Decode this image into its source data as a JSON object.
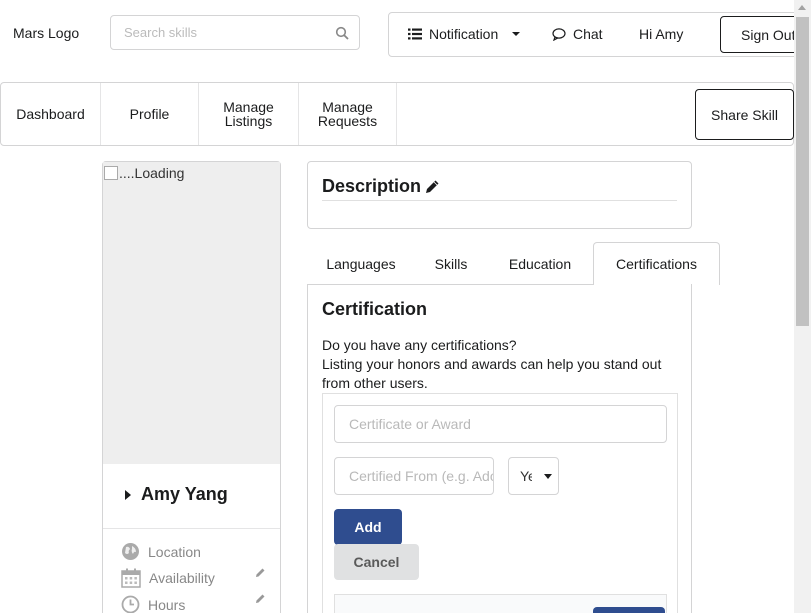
{
  "header": {
    "logo_text": "Mars Logo",
    "search_placeholder": "Search skills",
    "notification_label": "Notification",
    "chat_label": "Chat",
    "greeting": "Hi Amy",
    "sign_out_label": "Sign Out"
  },
  "nav": {
    "dashboard": "Dashboard",
    "profile": "Profile",
    "manage_listings": "Manage Listings",
    "manage_requests": "Manage Requests",
    "share_skill": "Share Skill"
  },
  "profile_card": {
    "photo_alt": "....Loading",
    "name": "Amy Yang",
    "location_label": "Location",
    "availability_label": "Availability",
    "hours_label": "Hours"
  },
  "description": {
    "title": "Description"
  },
  "tabs": {
    "languages": "Languages",
    "skills": "Skills",
    "education": "Education",
    "certifications": "Certifications"
  },
  "certification": {
    "heading": "Certification",
    "line1": "Do you have any certifications?",
    "line2": "Listing your honors and awards can help you stand out from other users.",
    "certificate_placeholder": "Certificate or Award",
    "from_placeholder": "Certified From (e.g. Adobe)",
    "year_value": "Year",
    "add_label": "Add",
    "cancel_label": "Cancel"
  },
  "colors": {
    "primary_button": "#2f4d8f",
    "secondary_button": "#e0e1e2"
  }
}
